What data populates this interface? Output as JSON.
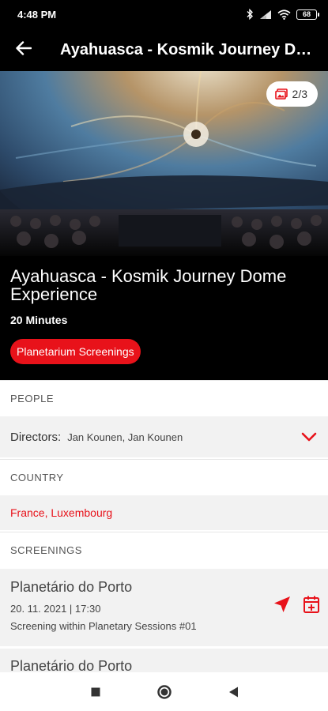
{
  "status_bar": {
    "time": "4:48 PM",
    "battery": "68"
  },
  "app_bar": {
    "title": "Ayahuasca - Kosmik Journey Dome Experience"
  },
  "hero": {
    "gallery_counter": "2/3"
  },
  "event": {
    "title": "Ayahuasca - Kosmik Journey Dome Experience",
    "duration": "20 Minutes",
    "category": "Planetarium Screenings"
  },
  "sections": {
    "people": "PEOPLE",
    "country": "COUNTRY",
    "screenings": "SCREENINGS"
  },
  "people": {
    "role": "Directors:",
    "names": "Jan Kounen, Jan Kounen"
  },
  "country": {
    "value": "France, Luxembourg"
  },
  "screenings": [
    {
      "venue": "Planetário do Porto",
      "datetime": "20. 11. 2021 | 17:30",
      "session": "Screening within Planetary Sessions #01"
    },
    {
      "venue": "Planetário do Porto"
    }
  ],
  "colors": {
    "accent": "#e8121a",
    "header_bg": "#000000",
    "row_bg": "#f2f2f2"
  }
}
